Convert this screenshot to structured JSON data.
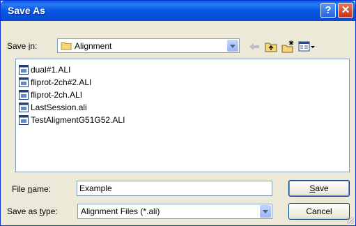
{
  "window": {
    "title": "Save As",
    "help_glyph": "?",
    "close_glyph": "✕"
  },
  "save_in": {
    "label_prefix": "Save ",
    "label_underlined": "i",
    "label_suffix": "n:",
    "value": "Alignment",
    "icon": "folder-icon"
  },
  "toolbar": {
    "icons": [
      "back-arrow-icon",
      "up-folder-icon",
      "new-folder-icon",
      "view-menu-icon"
    ]
  },
  "files": [
    {
      "name": "dual#1.ALI",
      "icon": "file-icon"
    },
    {
      "name": "fliprot-2ch#2.ALI",
      "icon": "file-icon"
    },
    {
      "name": "fliprot-2ch.ALI",
      "icon": "file-icon"
    },
    {
      "name": "LastSession.ali",
      "icon": "file-icon"
    },
    {
      "name": "TestAligmentG51G52.ALI",
      "icon": "file-icon"
    }
  ],
  "file_name": {
    "label_prefix": "File ",
    "label_underlined": "n",
    "label_suffix": "ame:",
    "value": "Example"
  },
  "save_as_type": {
    "label_prefix": "Save as ",
    "label_underlined": "t",
    "label_suffix": "ype:",
    "value": "Alignment Files (*.ali)"
  },
  "buttons": {
    "save_underlined": "S",
    "save_rest": "ave",
    "cancel": "Cancel"
  },
  "colors": {
    "titlebar": "#0a5ae8",
    "dialog_bg": "#ece9d8",
    "close_button": "#c0341c"
  }
}
